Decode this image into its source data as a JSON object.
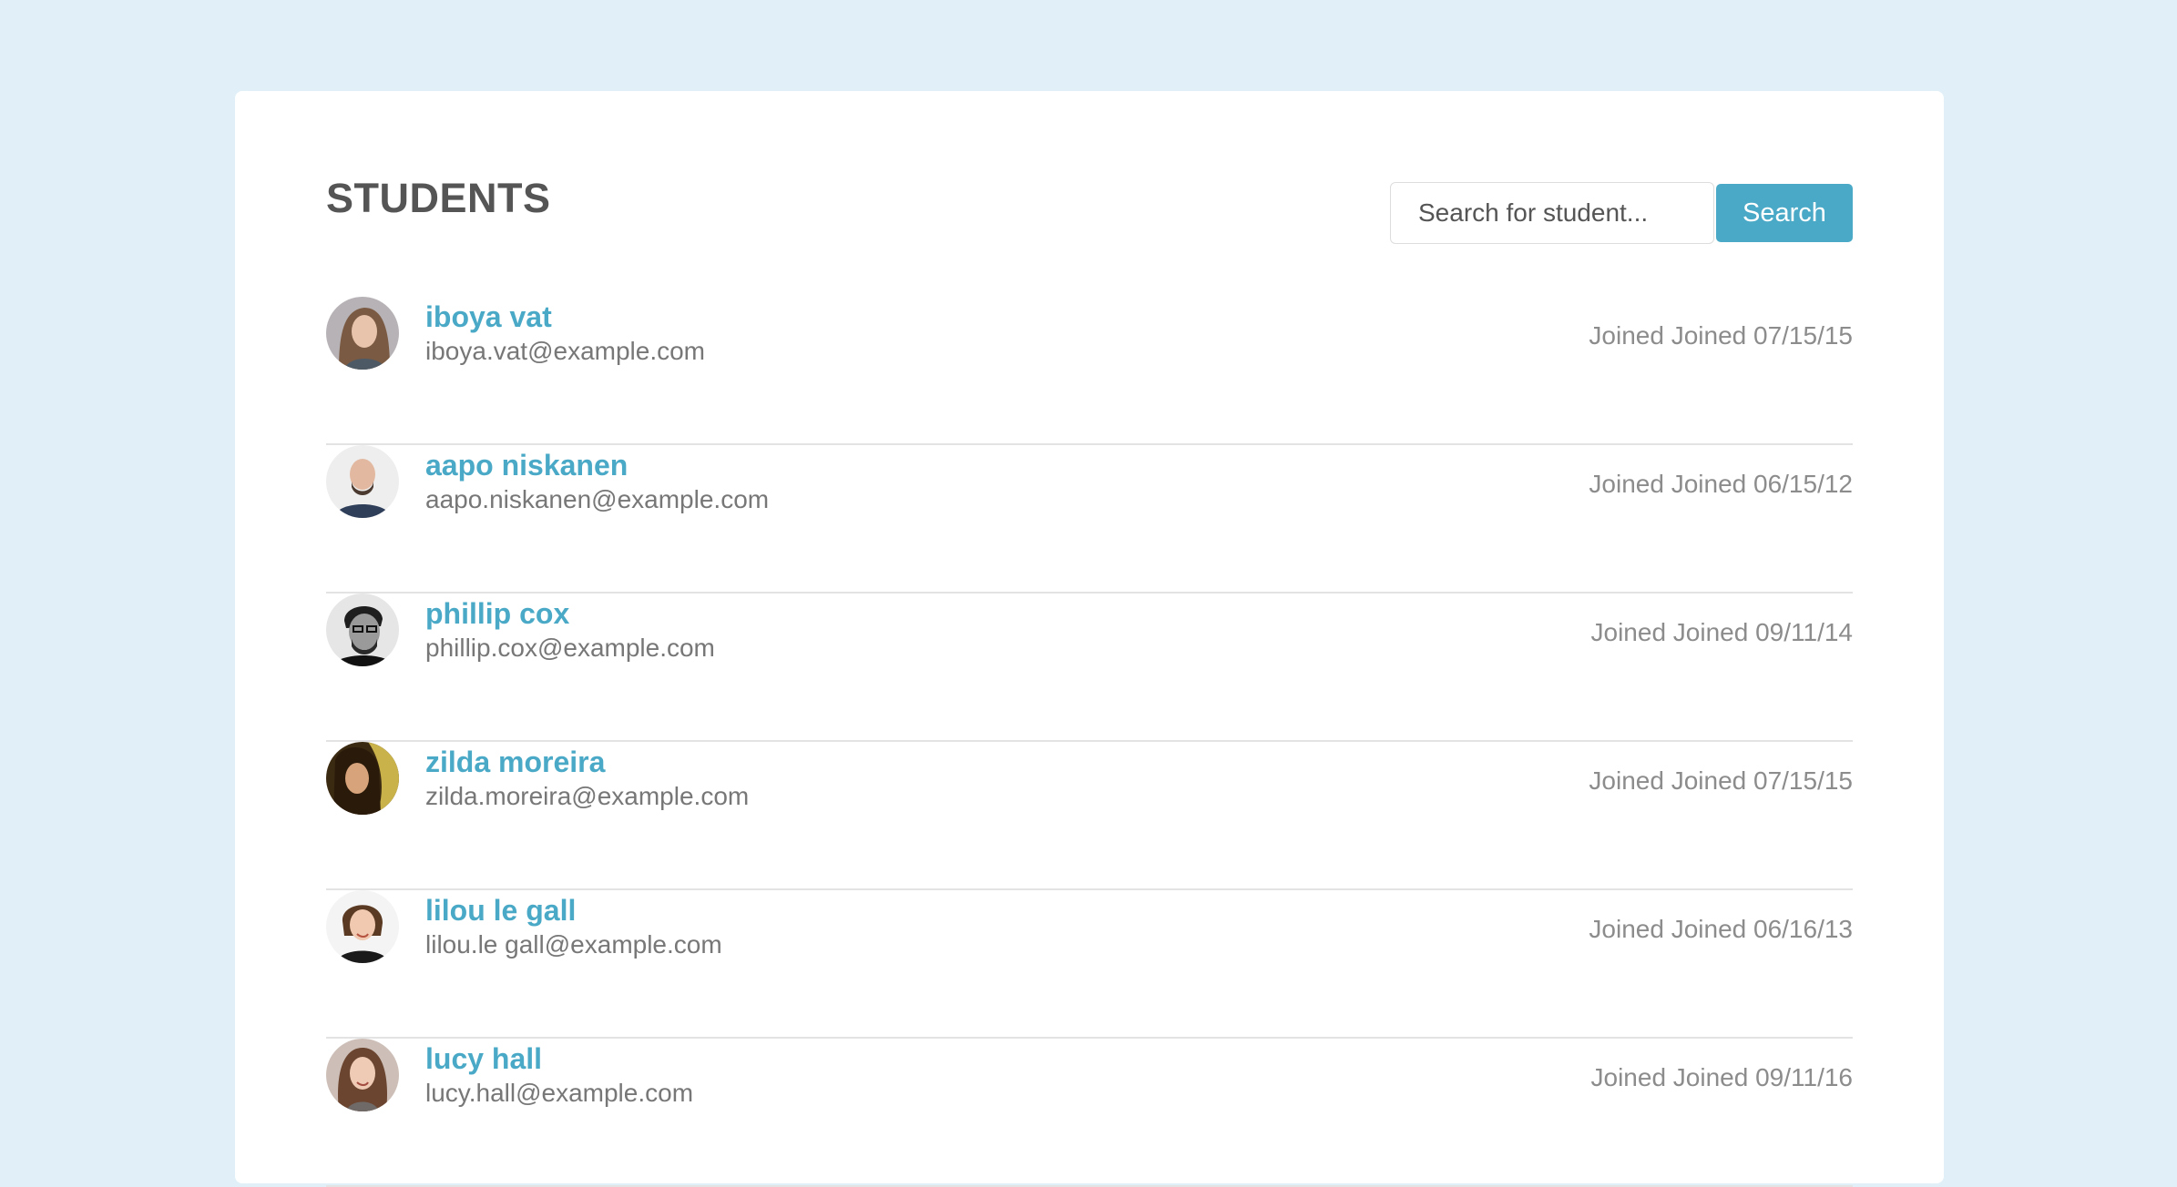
{
  "header": {
    "title": "STUDENTS",
    "search_placeholder": "Search for student...",
    "search_button": "Search"
  },
  "students": [
    {
      "name": "iboya vat",
      "email": "iboya.vat@example.com",
      "joined": "Joined Joined 07/15/15"
    },
    {
      "name": "aapo niskanen",
      "email": "aapo.niskanen@example.com",
      "joined": "Joined Joined 06/15/12"
    },
    {
      "name": "phillip cox",
      "email": "phillip.cox@example.com",
      "joined": "Joined Joined 09/11/14"
    },
    {
      "name": "zilda moreira",
      "email": "zilda.moreira@example.com",
      "joined": "Joined Joined 07/15/15"
    },
    {
      "name": "lilou le gall",
      "email": "lilou.le gall@example.com",
      "joined": "Joined Joined 06/16/13"
    },
    {
      "name": "lucy hall",
      "email": "lucy.hall@example.com",
      "joined": "Joined Joined 09/11/16"
    }
  ],
  "colors": {
    "background": "#e1f0f8",
    "card": "#ffffff",
    "accent": "#4aa9c6",
    "title": "#555555",
    "email": "#777777",
    "joined": "#8c8c8c",
    "divider": "#e3e3e3"
  }
}
